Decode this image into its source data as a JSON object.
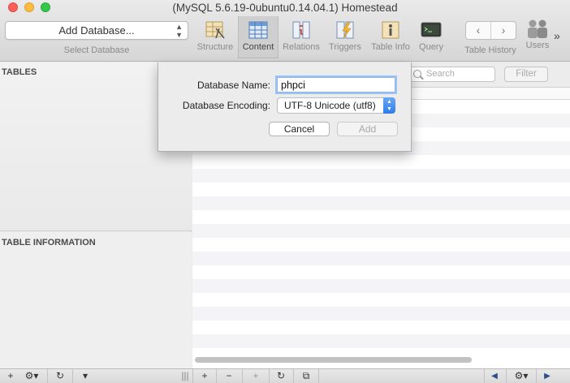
{
  "window": {
    "title": "(MySQL 5.6.19-0ubuntu0.14.04.1) Homestead"
  },
  "toolbar": {
    "database_select": "Add Database...",
    "database_caption": "Select Database",
    "buttons": [
      {
        "label": "Structure",
        "icon": "structure-icon"
      },
      {
        "label": "Content",
        "icon": "content-icon",
        "active": true
      },
      {
        "label": "Relations",
        "icon": "relations-icon"
      },
      {
        "label": "Triggers",
        "icon": "triggers-icon"
      },
      {
        "label": "Table Info",
        "icon": "table-info-icon"
      },
      {
        "label": "Query",
        "icon": "query-icon"
      }
    ],
    "history_caption": "Table History",
    "users_label": "Users",
    "nav_back": "‹",
    "nav_forward": "›",
    "overflow": "»"
  },
  "sidebar": {
    "tables_heading": "TABLES",
    "info_heading": "TABLE INFORMATION"
  },
  "content": {
    "search_placeholder": "Search",
    "filter_label": "Filter"
  },
  "dialog": {
    "name_label": "Database Name:",
    "name_value": "phpci",
    "encoding_label": "Database Encoding:",
    "encoding_value": "UTF-8 Unicode (utf8)",
    "cancel_label": "Cancel",
    "add_label": "Add"
  },
  "bottombar": {
    "add": "+",
    "gear": "⚙▾",
    "refresh": "↻",
    "filter_toggle": "▾",
    "resize": "|||",
    "row_add": "+",
    "row_remove": "−",
    "row_duplicate": "+",
    "row_refresh": "↻",
    "row_copy": "⧉",
    "prev": "◀",
    "rows_gear": "⚙▾",
    "next": "▶"
  },
  "colors": {
    "accent": "#2f7de9",
    "focus_ring": "#9cc3f5",
    "active_tab_bg": "#cfcfcf"
  }
}
